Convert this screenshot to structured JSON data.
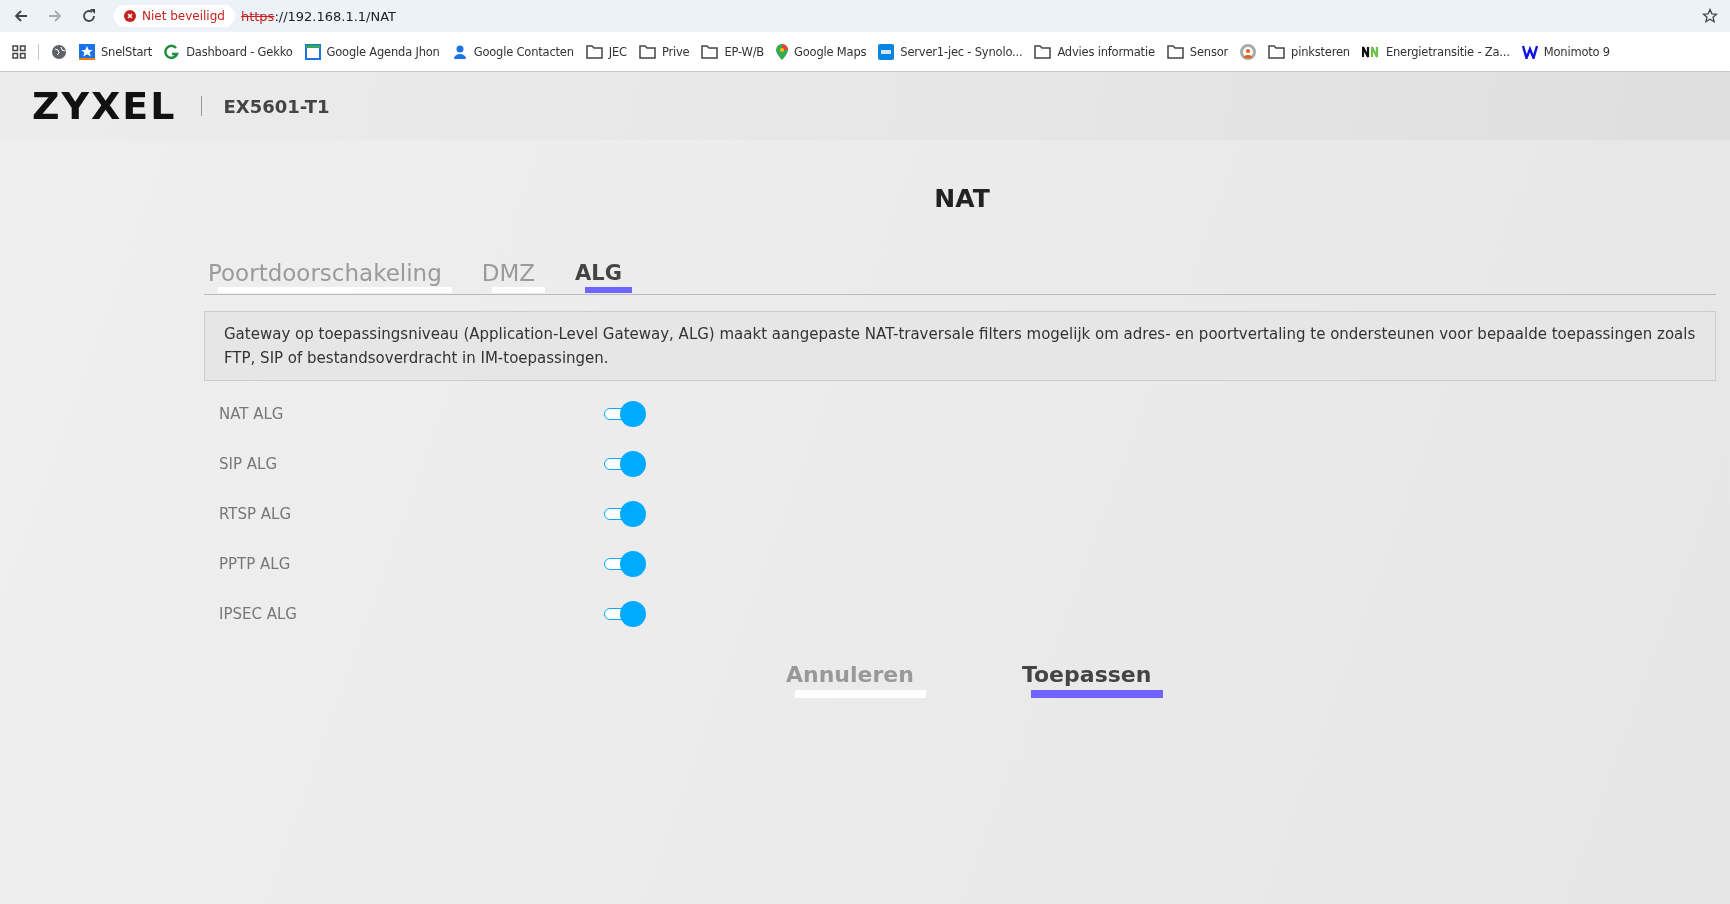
{
  "browser": {
    "security": "Niet beveiligd",
    "url_scheme": "https",
    "url_rest": "://192.168.1.1/NAT",
    "bookmarks": [
      {
        "kind": "globe"
      },
      {
        "label": "SnelStart",
        "kind": "star"
      },
      {
        "label": "Dashboard - Gekko",
        "kind": "gekko"
      },
      {
        "label": "Google Agenda Jhon",
        "kind": "calendar"
      },
      {
        "label": "Google Contacten",
        "kind": "person"
      },
      {
        "label": "JEC",
        "kind": "folder"
      },
      {
        "label": "Prive",
        "kind": "folder"
      },
      {
        "label": "EP-W/B",
        "kind": "folder"
      },
      {
        "label": "Google Maps",
        "kind": "pin"
      },
      {
        "label": "Server1-jec - Synolo...",
        "kind": "dsm"
      },
      {
        "label": "Advies  informatie",
        "kind": "folder"
      },
      {
        "label": "Sensor",
        "kind": "folder"
      },
      {
        "kind": "ring"
      },
      {
        "label": "pinksteren",
        "kind": "folder"
      },
      {
        "label": "Energietransitie - Za...",
        "kind": "nn"
      },
      {
        "label": "Monimoto 9",
        "kind": "w"
      }
    ]
  },
  "header": {
    "logo": "ZYXEL",
    "model": "EX5601-T1"
  },
  "page": {
    "title": "NAT",
    "tabs": [
      {
        "label": "Poortdoorschakeling",
        "selected": false
      },
      {
        "label": "DMZ",
        "selected": false
      },
      {
        "label": "ALG",
        "selected": true
      }
    ],
    "description": "Gateway op toepassingsniveau (Application-Level Gateway, ALG) maakt aangepaste NAT-traversale filters mogelijk om adres- en poortvertaling te ondersteunen voor bepaalde toepassingen zoals FTP, SIP of bestandsoverdracht in IM-toepassingen.",
    "settings": [
      {
        "label": "NAT ALG",
        "on": true
      },
      {
        "label": "SIP ALG",
        "on": true
      },
      {
        "label": "RTSP ALG",
        "on": true
      },
      {
        "label": "PPTP ALG",
        "on": true
      },
      {
        "label": "IPSEC ALG",
        "on": true
      }
    ],
    "buttons": [
      {
        "label": "Annuleren",
        "kind": "secondary"
      },
      {
        "label": "Toepassen",
        "kind": "primary"
      }
    ]
  }
}
